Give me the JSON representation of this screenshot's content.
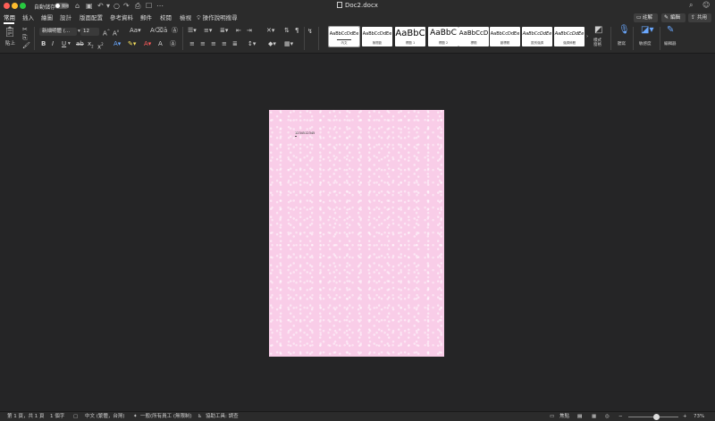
{
  "titlebar": {
    "autosave_label": "自動儲存",
    "autosave_state": "關閉",
    "document_title": "Doc2.docx"
  },
  "menu": {
    "tabs": [
      "常用",
      "插入",
      "繪圖",
      "設計",
      "版面配置",
      "參考資料",
      "郵件",
      "校閱",
      "檢視"
    ],
    "search_label": "操作說明搜尋",
    "comments_label": "註解",
    "edit_label": "編輯",
    "share_label": "共用"
  },
  "ribbon": {
    "paste_label": "貼上",
    "font_name": "新細明體 (...",
    "font_size": "12",
    "styles": [
      {
        "sample": "AaBbCcDdEe",
        "label": "內文"
      },
      {
        "sample": "AaBbCcDdEe",
        "label": "無間距"
      },
      {
        "sample": "AaBbC",
        "label": "標題 1"
      },
      {
        "sample": "AaBbC",
        "label": "標題 2"
      },
      {
        "sample": "AaBbCcD",
        "label": "標題"
      },
      {
        "sample": "AaBbCcDdEe",
        "label": "副標題"
      },
      {
        "sample": "AaBbCcDdEe",
        "label": "區別強調"
      },
      {
        "sample": "AaBbCcDdEe",
        "label": "強調斜體"
      }
    ],
    "styles_pane_label": "樣式\n窗格",
    "dictate_label": "聽寫",
    "sensitivity_label": "敏感度",
    "editor_label": "編輯器"
  },
  "document": {
    "body_text": "1234512345"
  },
  "statusbar": {
    "page_info": "第 1 頁，共 1 頁",
    "word_count": "1 個字",
    "language": "中文 (繁體，台灣)",
    "classification": "一般(所有員工 (無限制)",
    "accessibility": "協助工具: 調查",
    "focus_label": "焦點",
    "zoom": "73%"
  }
}
